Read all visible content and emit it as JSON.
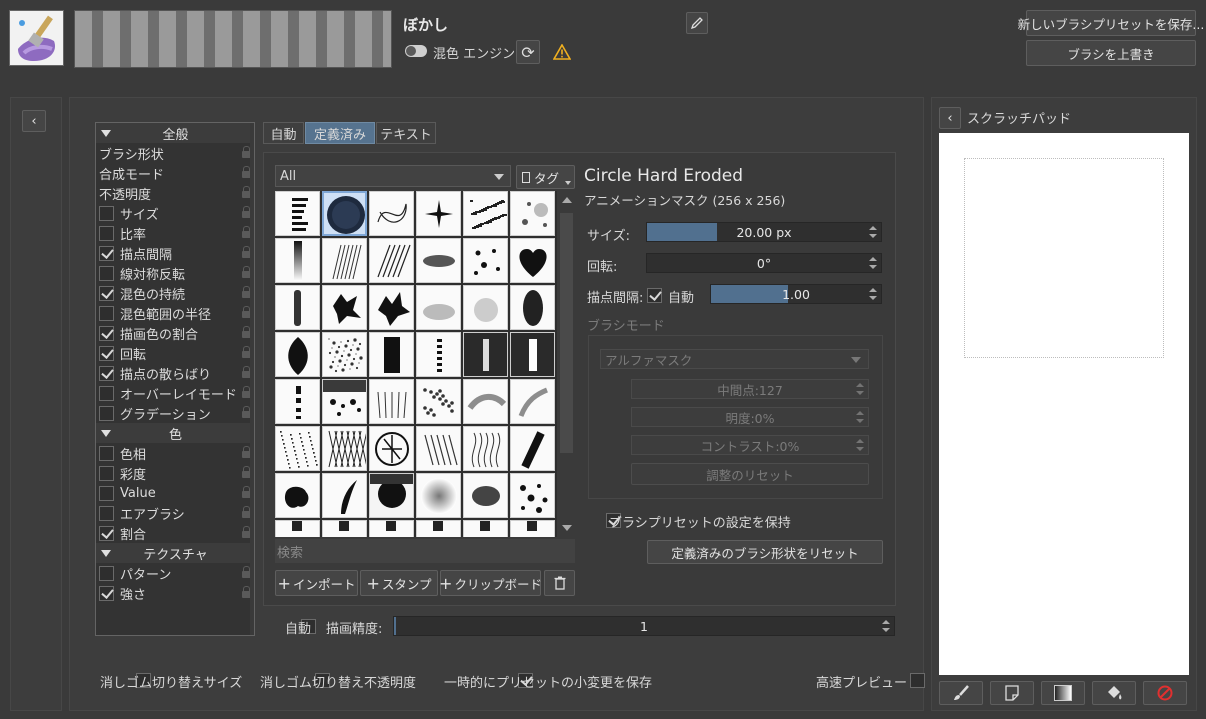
{
  "header": {
    "preset_name": "ぼかし",
    "blend_engine_label": "混色 エンジン",
    "save_new_preset": "新しいブラシプリセットを保存...",
    "overwrite_brush": "ブラシを上書き"
  },
  "options": {
    "sections": [
      {
        "title": "全般",
        "items": [
          {
            "label": "ブラシ形状",
            "check": null
          },
          {
            "label": "合成モード",
            "check": null
          },
          {
            "label": "不透明度",
            "check": null
          },
          {
            "label": "サイズ",
            "check": false
          },
          {
            "label": "比率",
            "check": false
          },
          {
            "label": "描点間隔",
            "check": true
          },
          {
            "label": "線対称反転",
            "check": false
          },
          {
            "label": "混色の持続",
            "check": true
          },
          {
            "label": "混色範囲の半径",
            "check": false
          },
          {
            "label": "描画色の割合",
            "check": true
          },
          {
            "label": "回転",
            "check": true
          },
          {
            "label": "描点の散らばり",
            "check": true
          },
          {
            "label": "オーバーレイモード",
            "check": false
          },
          {
            "label": "グラデーション",
            "check": false
          }
        ]
      },
      {
        "title": "色",
        "items": [
          {
            "label": "色相",
            "check": false
          },
          {
            "label": "彩度",
            "check": false
          },
          {
            "label": "Value",
            "check": false
          },
          {
            "label": "エアブラシ",
            "check": false
          },
          {
            "label": "割合",
            "check": true
          }
        ]
      },
      {
        "title": "テクスチャ",
        "items": [
          {
            "label": "パターン",
            "check": false
          },
          {
            "label": "強さ",
            "check": true
          }
        ]
      }
    ]
  },
  "tabs": [
    "自動",
    "定義済み",
    "テキスト"
  ],
  "active_tab": 1,
  "library": {
    "filter_value": "All",
    "tag_label": "タグ",
    "search_placeholder": "検索",
    "import_label": "インポート",
    "stamp_label": "スタンプ",
    "clipboard_label": "クリップボード"
  },
  "brush": {
    "name": "Circle Hard Eroded",
    "subtitle": "アニメーションマスク (256 x 256)",
    "size_label": "サイズ:",
    "size_value": "20.00 px",
    "size_fraction": 0.3,
    "rotation_label": "回転:",
    "rotation_value": "0°",
    "spacing_label": "描点間隔:",
    "spacing_auto_label": "自動",
    "spacing_value": "1.00",
    "spacing_fraction": 0.45,
    "brush_mode_title": "ブラシモード",
    "mode_value": "アルファマスク",
    "midpoint": "中間点:127",
    "brightness": "明度:0%",
    "contrast": "コントラスト:0%",
    "reset_adjust": "調整のリセット",
    "keep_settings_label": "ブラシプリセットの設定を保持",
    "reset_predefined": "定義済みのブラシ形状をリセット"
  },
  "precision": {
    "auto_label": "自動",
    "label": "描画精度:",
    "value": "1"
  },
  "footer": {
    "eraser_size": "消しゴム切り替えサイズ",
    "eraser_opacity": "消しゴム切り替え不透明度",
    "temp_save": "一時的にプリセットの小変更を保存",
    "fast_preview": "高速プレビュー"
  },
  "scratchpad": {
    "title": "スクラッチパッド"
  },
  "colors": {
    "accent_bar": "#51708f",
    "background": "#3a3a3a",
    "warning": "#f0b020",
    "clear_red": "#e03030"
  }
}
